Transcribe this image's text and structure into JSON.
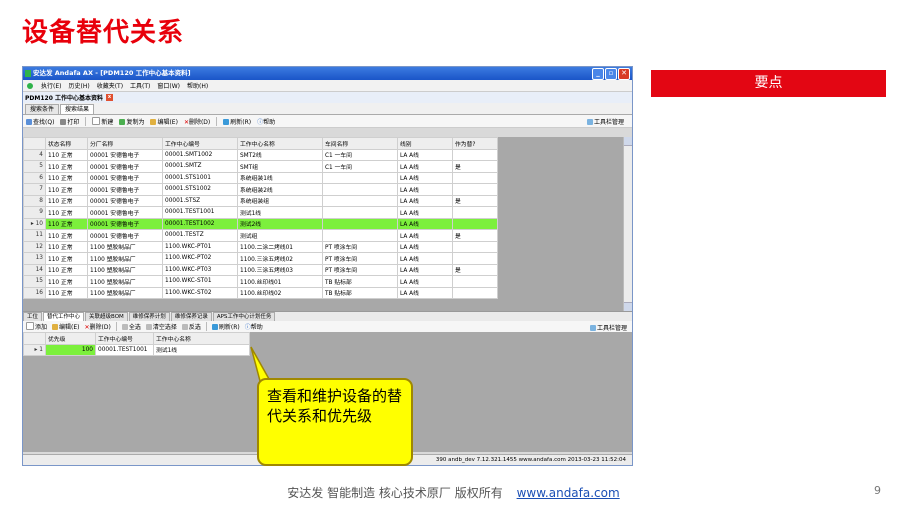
{
  "slide": {
    "title": "设备替代关系",
    "keypoint_label": "要点",
    "footer_text": "安达发   智能制造 核心技术原厂    版权所有",
    "footer_link": "www.andafa.com",
    "page_number": "9",
    "callout_text": "查看和维护设备的替代关系和优先级"
  },
  "window": {
    "title": "安达发 Andafa AX - [PDM120 工作中心基本资料]",
    "menu": [
      "执行(E)",
      "历史(H)",
      "收藏夹(T)",
      "工具(T)",
      "窗口(W)",
      "帮助(H)"
    ],
    "doc_tab": "PDM120 工作中心基本资料",
    "sub_tabs": [
      "搜索条件",
      "搜索结果"
    ],
    "toolbar1": [
      "查找(Q)",
      "打印",
      "新建",
      "复制为",
      "编辑(E)",
      "删除(D)",
      "刷新(R)",
      "帮助"
    ],
    "toolbar1_right": "工具栏管理",
    "grid1": {
      "columns": [
        "",
        "状态名称",
        "分厂名称",
        "工作中心编号",
        "工作中心名称",
        "车间名称",
        "线别",
        "作为替?"
      ],
      "rows": [
        [
          "4",
          "110 正常",
          "00001 安德鲁电子",
          "00001.SMT1002",
          "SMT2线",
          "C1 一车间",
          "LA A线",
          ""
        ],
        [
          "5",
          "110 正常",
          "00001 安德鲁电子",
          "00001.SMTZ",
          "SMT组",
          "C1 一车间",
          "LA A线",
          "是"
        ],
        [
          "6",
          "110 正常",
          "00001 安德鲁电子",
          "00001.STS1001",
          "系统组装1线",
          "",
          "LA A线",
          ""
        ],
        [
          "7",
          "110 正常",
          "00001 安德鲁电子",
          "00001.STS1002",
          "系统组装2线",
          "",
          "LA A线",
          ""
        ],
        [
          "8",
          "110 正常",
          "00001 安德鲁电子",
          "00001.STSZ",
          "系统组装组",
          "",
          "LA A线",
          "是"
        ],
        [
          "9",
          "110 正常",
          "00001 安德鲁电子",
          "00001.TEST1001",
          "测试1线",
          "",
          "LA A线",
          ""
        ],
        [
          "10",
          "110 正常",
          "00001 安德鲁电子",
          "00001.TEST1002",
          "测试2线",
          "",
          "LA A线",
          ""
        ],
        [
          "11",
          "110 正常",
          "00001 安德鲁电子",
          "00001.TESTZ",
          "测试组",
          "",
          "LA A线",
          "是"
        ],
        [
          "12",
          "110 正常",
          "1100 塑胶制品厂",
          "1100.WKC-PT01",
          "1100.二涂二烤线01",
          "PT 喷涂车间",
          "LA A线",
          ""
        ],
        [
          "13",
          "110 正常",
          "1100 塑胶制品厂",
          "1100.WKC-PT02",
          "1100.三涂五烤线02",
          "PT 喷涂车间",
          "LA A线",
          ""
        ],
        [
          "14",
          "110 正常",
          "1100 塑胶制品厂",
          "1100.WKC-PT03",
          "1100.三涂五烤线03",
          "PT 喷涂车间",
          "LA A线",
          "是"
        ],
        [
          "15",
          "110 正常",
          "1100 塑胶制品厂",
          "1100.WKC-ST01",
          "1100.丝印线01",
          "TB 贴标部",
          "LA A线",
          ""
        ],
        [
          "16",
          "110 正常",
          "1100 塑胶制品厂",
          "1100.WKC-ST02",
          "1100.丝印线02",
          "TB 贴标部",
          "LA A线",
          ""
        ]
      ],
      "selected_row_index": 6
    },
    "bottom_tabs": [
      "工位",
      "替代工作中心",
      "关联超级BOM",
      "维修保养计划",
      "维修保养记录",
      "APS工作中心计划任务"
    ],
    "toolbar2": [
      "添加",
      "编辑(E)",
      "删除(D)",
      "全选",
      "清空选择",
      "反选",
      "刷新(R)",
      "帮助"
    ],
    "toolbar2_right": "工具栏管理",
    "grid2": {
      "columns": [
        "",
        "优先级",
        "工作中心编号",
        "工作中心名称"
      ],
      "rows": [
        [
          "1",
          "100",
          "00001.TEST1001",
          "测试1线"
        ]
      ]
    },
    "status_text": "390  andb_dev  7.12.321.1455  www.andafa.com  2013-03-23 11:52:04"
  },
  "colors": {
    "title_red": "#e8000b",
    "keypoint_red": "#e30613",
    "selected_row": "#7cf03c",
    "callout_yellow": "#ffff00"
  }
}
